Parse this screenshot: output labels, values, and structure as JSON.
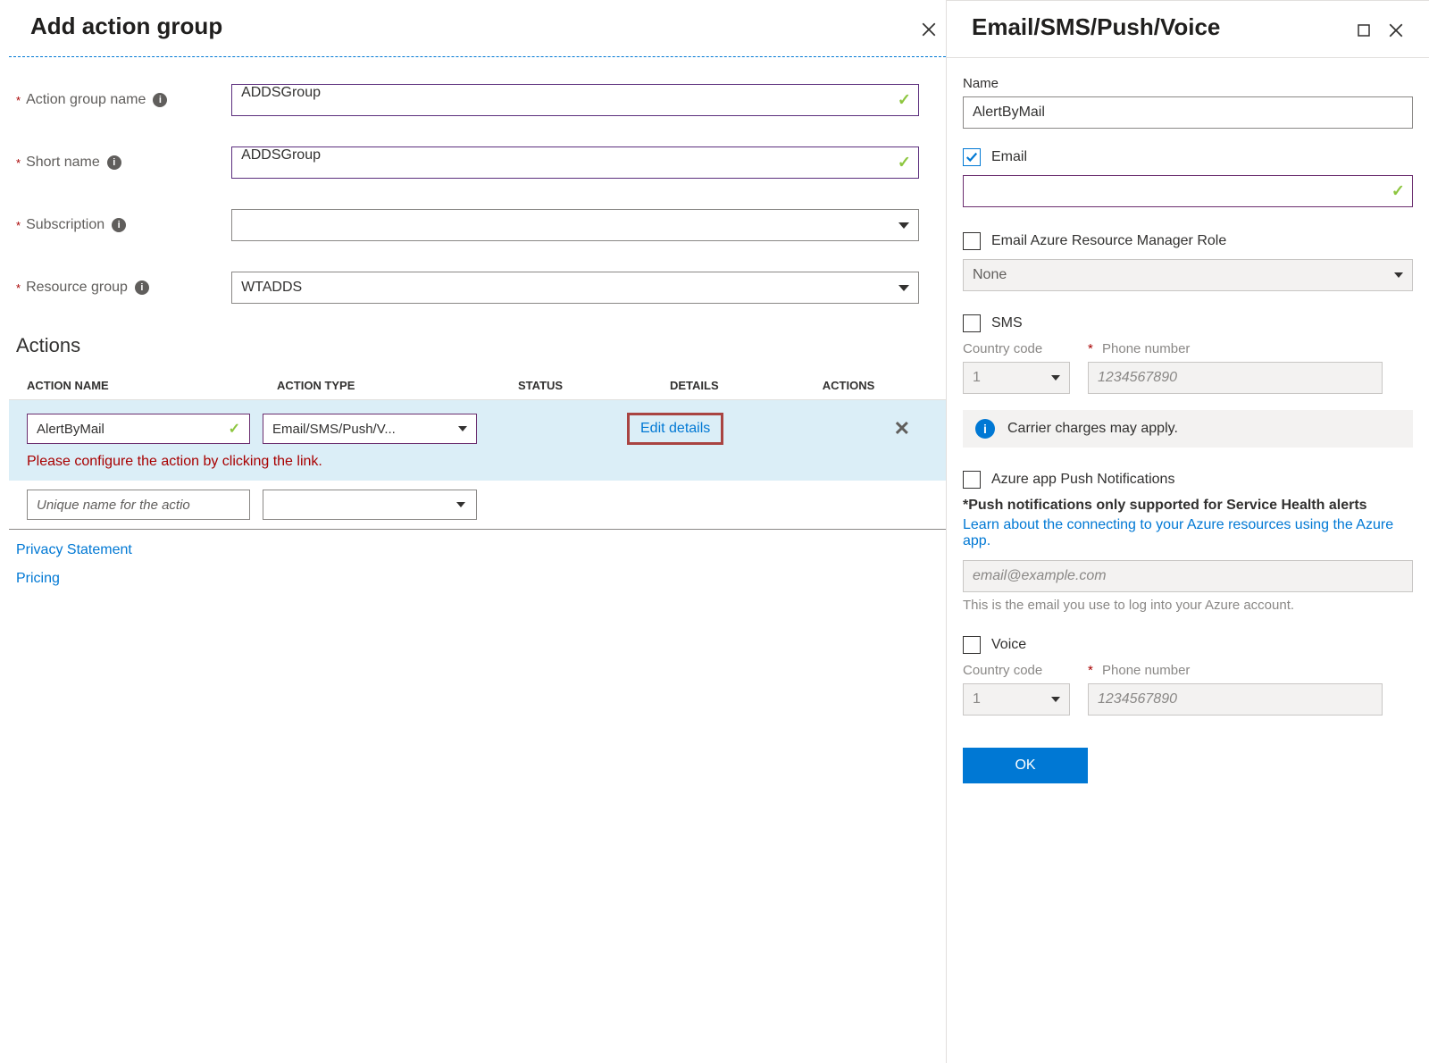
{
  "left": {
    "title": "Add action group",
    "fields": {
      "action_group_name_label": "Action group name",
      "action_group_name_value": "ADDSGroup",
      "short_name_label": "Short name",
      "short_name_value": "ADDSGroup",
      "subscription_label": "Subscription",
      "subscription_value": "",
      "resource_group_label": "Resource group",
      "resource_group_value": "WTADDS"
    },
    "actions_heading": "Actions",
    "table": {
      "col_name": "ACTION NAME",
      "col_type": "ACTION TYPE",
      "col_status": "STATUS",
      "col_details": "DETAILS",
      "col_actions": "ACTIONS"
    },
    "row": {
      "name_value": "AlertByMail",
      "type_value": "Email/SMS/Push/V...",
      "edit_link": "Edit details",
      "error": "Please configure the action by clicking the link."
    },
    "blank_placeholder": "Unique name for the actio",
    "privacy_link": "Privacy Statement",
    "pricing_link": "Pricing"
  },
  "right": {
    "title": "Email/SMS/Push/Voice",
    "name_label": "Name",
    "name_value": "AlertByMail",
    "email_label": "Email",
    "email_checked": true,
    "email_value": "",
    "arm_role_label": "Email Azure Resource Manager Role",
    "arm_role_value": "None",
    "sms_label": "SMS",
    "country_code_label": "Country code",
    "country_code_value": "1",
    "phone_label": "Phone number",
    "phone_placeholder": "1234567890",
    "carrier_note": "Carrier charges may apply.",
    "push_label": "Azure app Push Notifications",
    "push_note": "*Push notifications only supported for Service Health alerts",
    "push_link": "Learn about the connecting to your Azure resources using the Azure app.",
    "push_email_placeholder": "email@example.com",
    "push_helper": "This is the email you use to log into your Azure account.",
    "voice_label": "Voice",
    "ok_label": "OK"
  }
}
